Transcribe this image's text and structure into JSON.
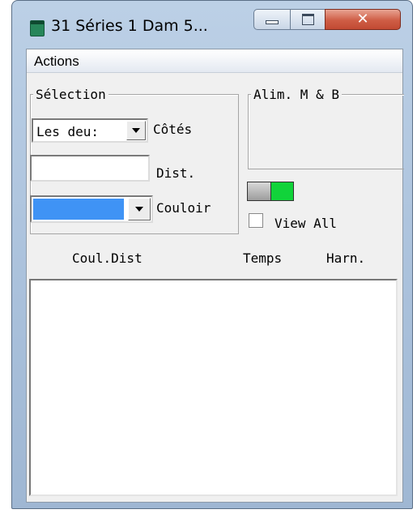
{
  "window": {
    "title": "31 Séries 1  Dam 5...",
    "close_glyph": "✕",
    "icons": {
      "app": "app-icon",
      "minimize": "minimize-icon",
      "maximize": "maximize-icon",
      "close": "close-icon"
    },
    "colors": {
      "close_button": "#c14a33",
      "frame": "#a9c0db",
      "client": "#f0f0f0"
    }
  },
  "menu": {
    "items": [
      {
        "label": "Actions"
      }
    ]
  },
  "selection": {
    "legend": "Sélection",
    "sides_combo": {
      "value": "Les deu:",
      "label": "Côtés"
    },
    "distance": {
      "value": "",
      "label": "Dist."
    },
    "lane_combo": {
      "color": "#3f93f5",
      "label": "Couloir"
    }
  },
  "alim": {
    "legend": "Alim. M & B"
  },
  "toggle": {
    "state": "on",
    "on_color": "#11d33a"
  },
  "view_all": {
    "label": "View All",
    "checked": false
  },
  "columns": {
    "coul_dist": "Coul.Dist",
    "temps": "Temps",
    "harn": "Harn."
  },
  "results_list": {
    "items": []
  }
}
